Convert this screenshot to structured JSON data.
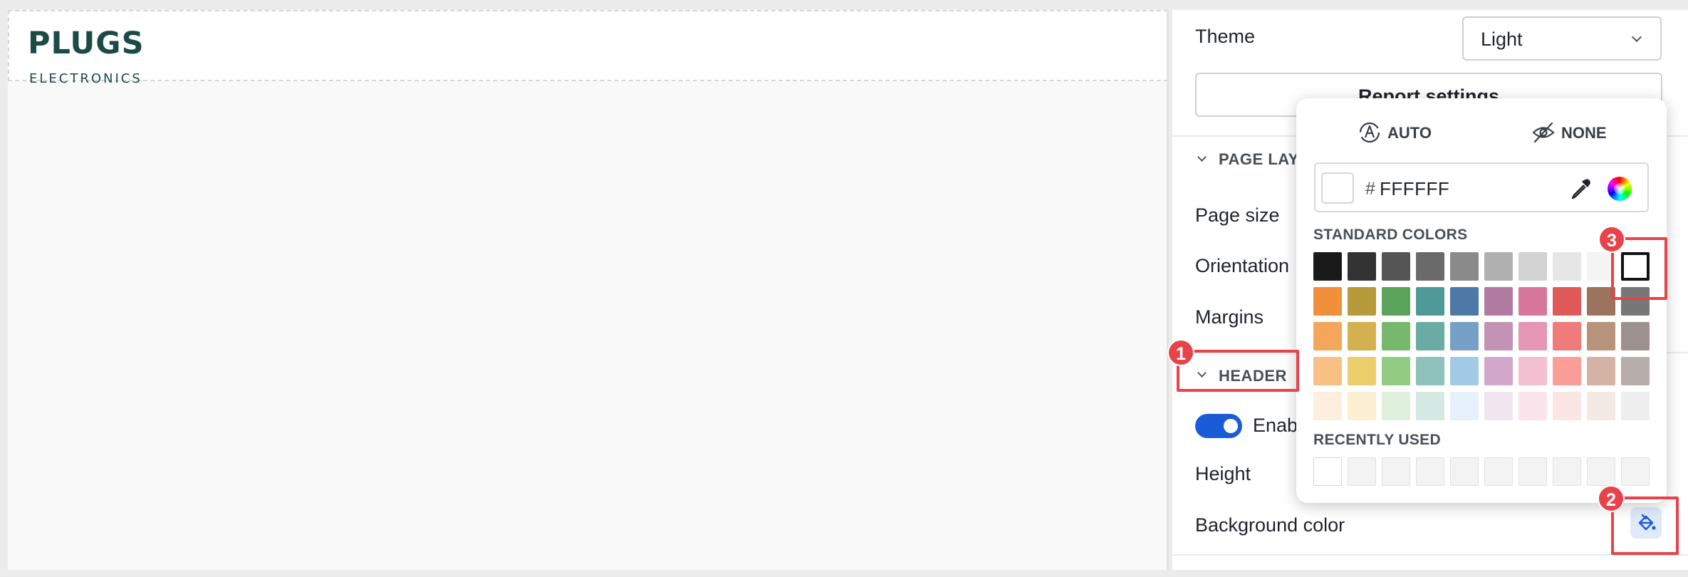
{
  "logo": {
    "brand": "PLUGS",
    "sub": "ELECTRONICS"
  },
  "panel": {
    "theme_label": "Theme",
    "theme_value": "Light",
    "report_settings_label": "Report settings",
    "page_layout_title": "PAGE LAYOUT",
    "page_size_label": "Page size",
    "orientation_label": "Orientation",
    "margins_label": "Margins",
    "header_title": "HEADER",
    "enable_label": "Enable header",
    "height_label": "Height",
    "background_color_label": "Background color",
    "icons": {
      "fill": "paint-bucket-icon"
    }
  },
  "picker": {
    "auto_label": "AUTO",
    "none_label": "NONE",
    "hash": "#",
    "hex_value": "FFFFFF",
    "standard_title": "STANDARD COLORS",
    "recent_title": "RECENTLY USED",
    "selected_color": "#FFFFFF",
    "standard_colors": [
      [
        "#1a1a1a",
        "#333333",
        "#555555",
        "#6a6a6a",
        "#8a8a8a",
        "#b0b0b0",
        "#d2d2d2",
        "#e6e6e6",
        "#f4f4f4",
        "#ffffff"
      ],
      [
        "#f0903a",
        "#b69a3c",
        "#5ba35a",
        "#4f9a98",
        "#4e79a7",
        "#b07aa1",
        "#d7789a",
        "#e05a5a",
        "#9c735c",
        "#777777"
      ],
      [
        "#f4a75a",
        "#d4b14f",
        "#76b96c",
        "#6aaca4",
        "#77a0c8",
        "#c492b5",
        "#e496b2",
        "#ef7b7b",
        "#b8937c",
        "#9d918d"
      ],
      [
        "#f8c083",
        "#eccd6b",
        "#92cc83",
        "#8dc1bb",
        "#a2c9e6",
        "#d4a8cb",
        "#f4c0d1",
        "#fb9e98",
        "#d4b3a5",
        "#b7adaa"
      ],
      [
        "#fdeee0",
        "#fdf0d2",
        "#dff0dc",
        "#d4e8e4",
        "#e6f1fb",
        "#f0e6ef",
        "#fbe4eb",
        "#fce6e4",
        "#f3eae6",
        "#eeeeee"
      ]
    ],
    "recent_colors": [
      "#ffffff",
      "#f3f3f3",
      "#f3f3f3",
      "#f3f3f3",
      "#f3f3f3",
      "#f3f3f3",
      "#f3f3f3",
      "#f3f3f3",
      "#f3f3f3",
      "#f3f3f3"
    ]
  },
  "annotations": {
    "badge_1": "1",
    "badge_2": "2",
    "badge_3": "3"
  },
  "colors": {
    "accent": "#1a5bd6",
    "annotation": "#e8434b",
    "logo": "#1c4a47"
  }
}
